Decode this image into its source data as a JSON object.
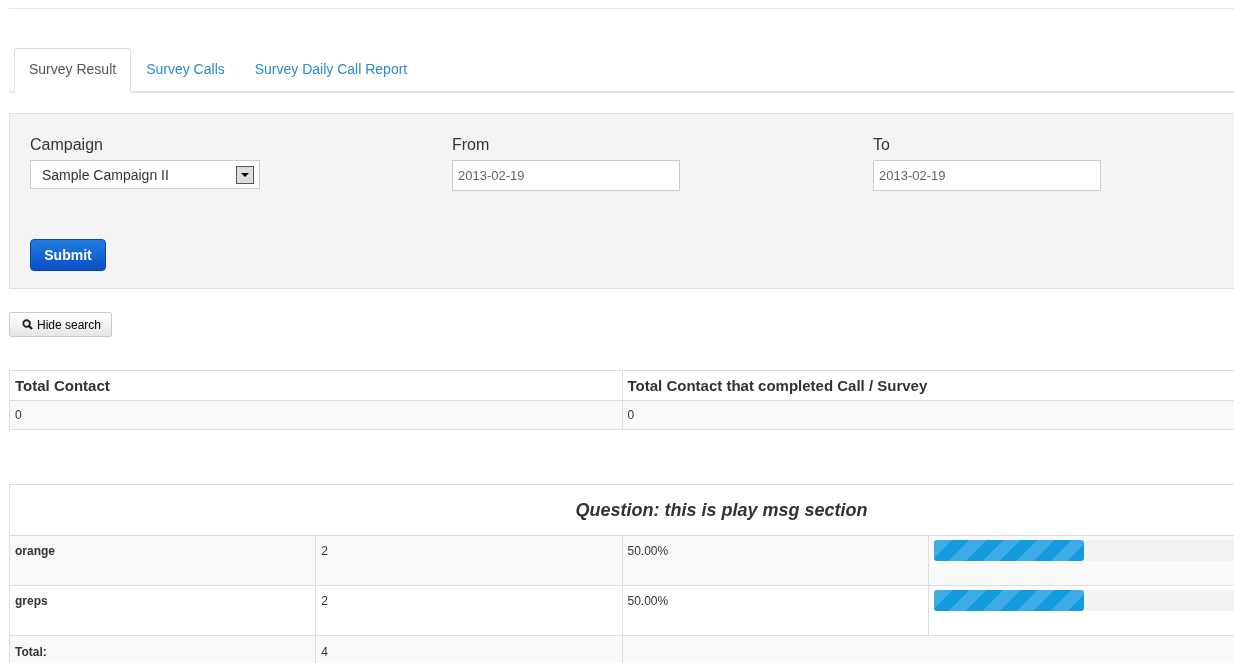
{
  "tabs": [
    {
      "label": "Survey Result",
      "selected": true
    },
    {
      "label": "Survey Calls",
      "selected": false
    },
    {
      "label": "Survey Daily Call Report",
      "selected": false
    }
  ],
  "filters": {
    "campaign": {
      "label": "Campaign",
      "value": "Sample Campaign II"
    },
    "from": {
      "label": "From",
      "value": "2013-02-19"
    },
    "to": {
      "label": "To",
      "value": "2013-02-19"
    },
    "submit": "Submit"
  },
  "hide_search": "Hide search",
  "totals": {
    "columns": [
      "Total Contact",
      "Total Contact that completed Call / Survey"
    ],
    "values": [
      "0",
      "0"
    ]
  },
  "question": {
    "title": "Question: this is play msg section",
    "answers": [
      {
        "label": "orange",
        "count": "2",
        "percent": "50.00%",
        "level": 0.5
      },
      {
        "label": "greps",
        "count": "2",
        "percent": "50.00%",
        "level": 0.5
      }
    ],
    "total_label": "Total:",
    "total": "4"
  }
}
